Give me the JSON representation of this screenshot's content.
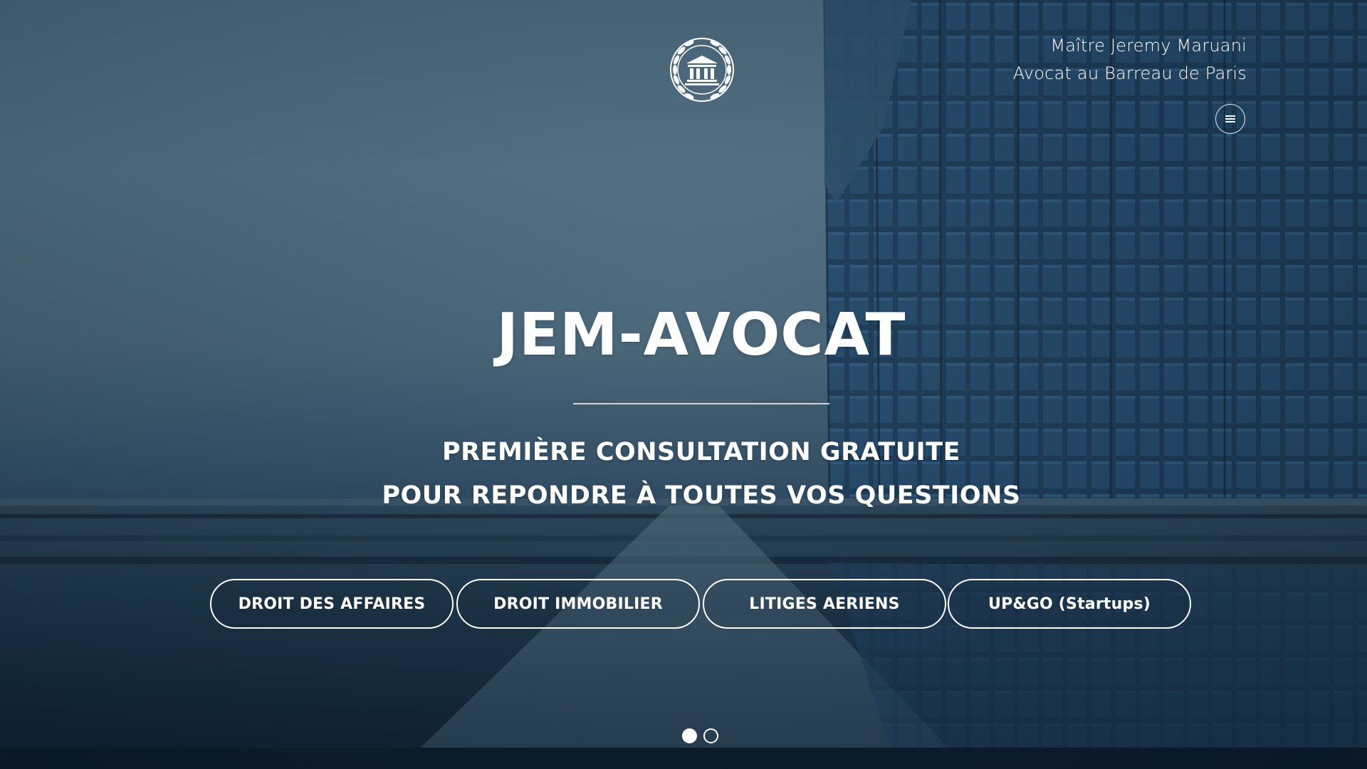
{
  "colors": {
    "text": "#ffffff",
    "sky": "#557385",
    "building": "#1d3d5c",
    "water": "#0f2234"
  },
  "header": {
    "logo_icon": "courthouse-laurel-icon",
    "lawyer_name": "Maître Jeremy Maruani",
    "lawyer_title": "Avocat au Barreau de Paris",
    "menu_icon": "hamburger-menu-icon"
  },
  "hero": {
    "title": "JEM-AVOCAT",
    "tagline_line1": "PREMIÈRE CONSULTATION GRATUITE",
    "tagline_line2": "POUR REPONDRE À TOUTES VOS QUESTIONS"
  },
  "practice_areas": [
    {
      "label": "DROIT DES AFFAIRES"
    },
    {
      "label": "DROIT IMMOBILIER"
    },
    {
      "label": "LITIGES AERIENS"
    },
    {
      "label": "UP&GO (Startups)"
    }
  ],
  "slider": {
    "total_slides": 2,
    "active_index": 0
  }
}
